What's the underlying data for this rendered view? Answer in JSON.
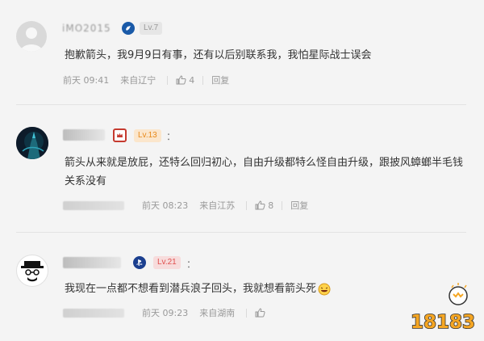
{
  "comments": [
    {
      "username": "iMO2015",
      "level": "Lv.7",
      "level_color": "#999999",
      "text": "抱歉箭头，我9月9日有事，还有以后别联系我，我怕星际战士误会",
      "time": "前天 09:41",
      "location": "来自辽宁",
      "likes": "4",
      "reply": "回复"
    },
    {
      "username": "",
      "level": "Lv.13",
      "level_color": "#e8891a",
      "colon": "：",
      "text": "箭头从来就是放屁，还特么回归初心，自由升级都特么怪自由升级，跟披风蟑螂半毛钱关系没有",
      "time": "前天 08:23",
      "location": "来自江苏",
      "likes": "8",
      "reply": "回复"
    },
    {
      "username": "",
      "level": "Lv.21",
      "level_color": "#e0504f",
      "colon": "：",
      "text": "我现在一点都不想看到潜兵浪子回头，我就想看箭头死",
      "time": "前天 09:23",
      "location": "来自湖南",
      "likes": "",
      "reply": "回复"
    }
  ],
  "watermark": {
    "text": "18183",
    "colors": {
      "orange": "#f5a623",
      "outline": "#333333"
    }
  },
  "icons": [
    "avatar-placeholder-icon",
    "verified-badge-icon",
    "crown-badge-icon",
    "playstation-badge-icon",
    "thumbs-up-icon",
    "laughing-emoji-icon"
  ]
}
